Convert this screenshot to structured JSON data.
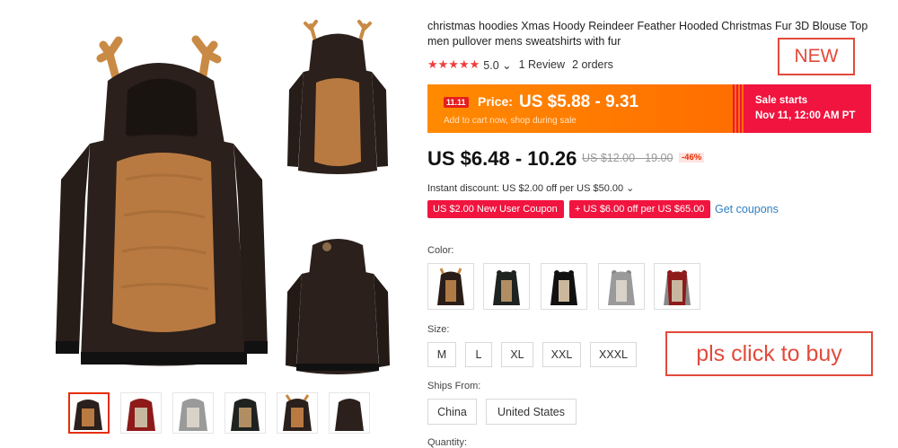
{
  "product": {
    "title": "christmas hoodies Xmas Hoody Reindeer Feather Hooded Christmas Fur 3D Blouse Top men pullover mens sweatshirts with fur",
    "new_label": "NEW",
    "rating": {
      "stars": 5,
      "score_text": "5.0 ⌄",
      "reviews_text": "1 Review",
      "orders_text": "2 orders"
    }
  },
  "promo_banner": {
    "badge": "11.11",
    "price_label": "Price:",
    "price_range": "US $5.88 - 9.31",
    "subtitle": "Add to cart now, shop during sale",
    "sale_title": "Sale starts",
    "sale_date": "Nov 11, 12:00 AM PT",
    "colors": {
      "orange": "#ff8a00",
      "red": "#f0143f"
    }
  },
  "pricing": {
    "current": "US $6.48 - 10.26",
    "original": "US $12.00 - 19.00",
    "discount": "-46%",
    "instant_discount": "Instant discount: US $2.00 off per US $50.00 ⌄",
    "coupons": [
      "US $2.00 New User Coupon",
      "+ US $6.00 off per US $65.00"
    ],
    "get_coupons": "Get coupons"
  },
  "options": {
    "color_label": "Color:",
    "colors": [
      {
        "name": "brown-antler",
        "body": "#2a1d17",
        "belly": "#b07a45",
        "sleeve": "#2a1d17",
        "ear": "#c98a45"
      },
      {
        "name": "black-ears",
        "body": "#1f2320",
        "belly": "#b08d63",
        "sleeve": "#1f2320",
        "ear": "#222"
      },
      {
        "name": "black-white",
        "body": "#111",
        "belly": "#cbb79b",
        "sleeve": "#111",
        "ear": "#111"
      },
      {
        "name": "gray",
        "body": "#9a9a9a",
        "belly": "#d8d2c8",
        "sleeve": "#9a9a9a",
        "ear": "#888"
      },
      {
        "name": "red-gray",
        "body": "#8e1a1a",
        "belly": "#c7b79f",
        "sleeve": "#888",
        "ear": "#8e1a1a"
      }
    ],
    "size_label": "Size:",
    "sizes": [
      "M",
      "L",
      "XL",
      "XXL",
      "XXXL"
    ],
    "ships_label": "Ships From:",
    "ships_from": [
      "China",
      "United States"
    ],
    "quantity_label": "Quantity:"
  },
  "cta_text": "pls click to buy",
  "gallery": {
    "main_colors": {
      "body": "#2b201b",
      "belly": "#b97a42",
      "antler": "#c98a45"
    },
    "thumbnail_count": 6
  }
}
